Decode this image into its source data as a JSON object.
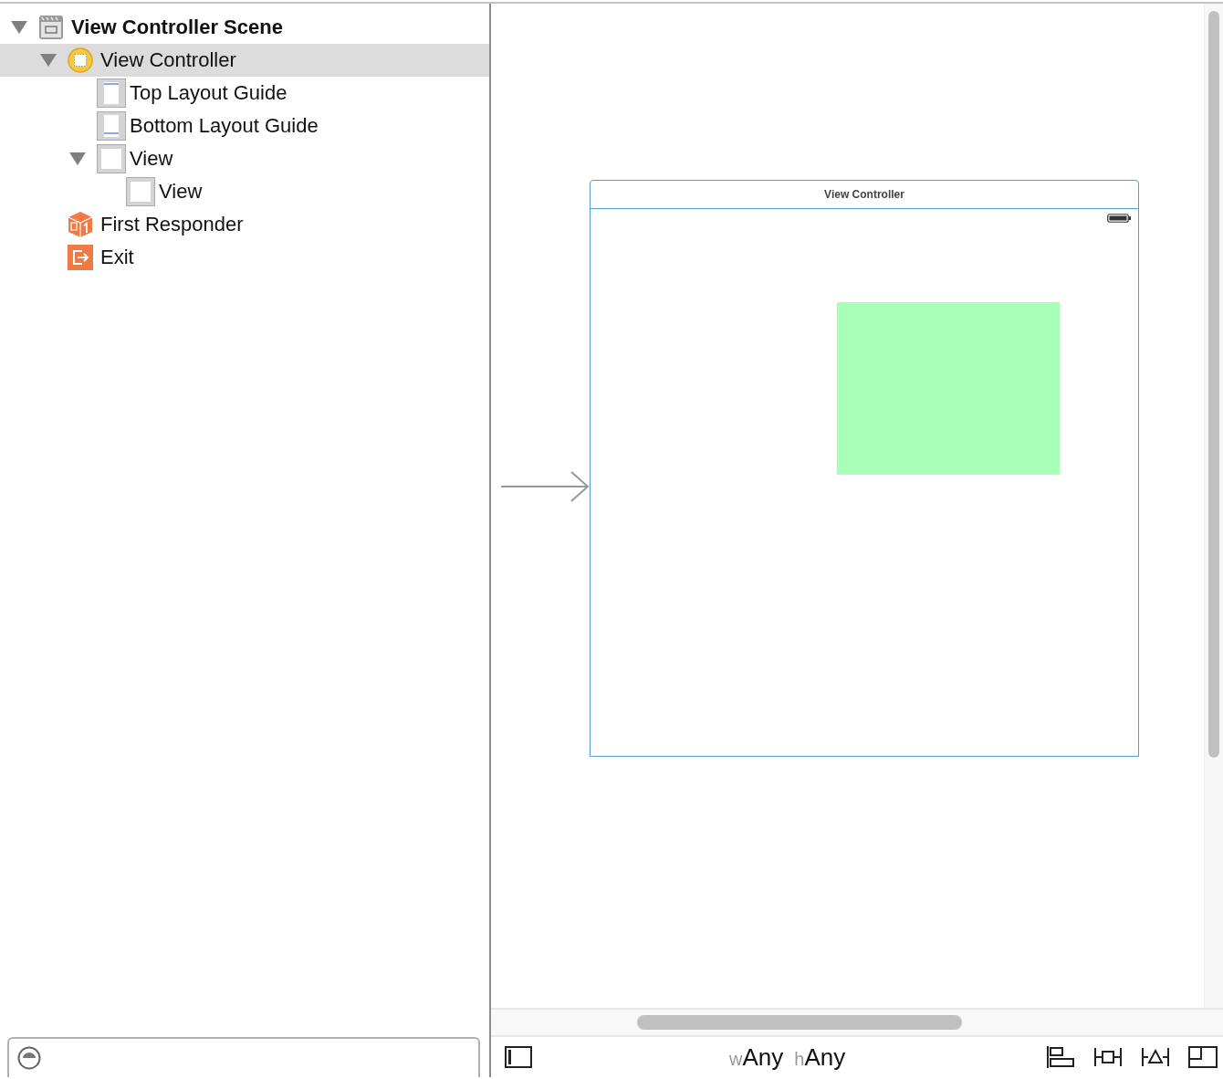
{
  "outline": [
    {
      "kind": "scene",
      "label": "View Controller Scene",
      "expanded": true,
      "selected": false,
      "children": [
        {
          "kind": "controller",
          "label": "View Controller",
          "expanded": true,
          "selected": true,
          "children": [
            {
              "kind": "guide-top",
              "label": "Top Layout Guide",
              "selected": false
            },
            {
              "kind": "guide-bottom",
              "label": "Bottom Layout Guide",
              "selected": false
            },
            {
              "kind": "view",
              "label": "View",
              "expanded": true,
              "selected": false,
              "children": [
                {
                  "kind": "view",
                  "label": "View",
                  "selected": false
                }
              ]
            }
          ]
        },
        {
          "kind": "responder",
          "label": "First Responder",
          "selected": false
        },
        {
          "kind": "exit",
          "label": "Exit",
          "selected": false
        }
      ]
    }
  ],
  "canvas": {
    "scene_title": "View Controller"
  },
  "size_class": {
    "w_prefix": "w",
    "w_value": "Any",
    "h_prefix": "h",
    "h_value": "Any"
  }
}
